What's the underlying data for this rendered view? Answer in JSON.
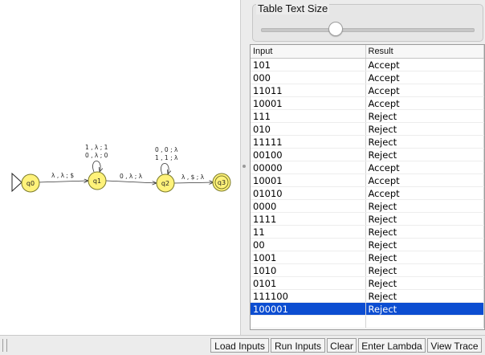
{
  "automaton": {
    "states": [
      "q0",
      "q1",
      "q2",
      "q3"
    ],
    "edges": [
      {
        "from": "q0",
        "to": "q1",
        "label": "λ , λ ; $"
      },
      {
        "from": "q1",
        "to": "q1",
        "labels": [
          "1 , λ ; 1",
          "0 , λ ; 0"
        ]
      },
      {
        "from": "q1",
        "to": "q2",
        "label": "0 , λ ; λ"
      },
      {
        "from": "q2",
        "to": "q2",
        "labels": [
          "0 , 0 ; λ",
          "1 , 1 ; λ"
        ]
      },
      {
        "from": "q2",
        "to": "q3",
        "label": "λ , $ ; λ"
      }
    ],
    "initial": "q0",
    "final": "q3",
    "colors": {
      "state_fill": "#fff27a",
      "state_border": "#7a7a2a"
    }
  },
  "table_text_size": {
    "title": "Table Text Size",
    "value": 0.35
  },
  "results_table": {
    "headers": [
      "Input",
      "Result"
    ],
    "rows": [
      [
        "101",
        "Accept"
      ],
      [
        "000",
        "Accept"
      ],
      [
        "11011",
        "Accept"
      ],
      [
        "10001",
        "Accept"
      ],
      [
        "111",
        "Reject"
      ],
      [
        "010",
        "Reject"
      ],
      [
        "11111",
        "Reject"
      ],
      [
        "00100",
        "Reject"
      ],
      [
        "00000",
        "Accept"
      ],
      [
        "10001",
        "Accept"
      ],
      [
        "01010",
        "Accept"
      ],
      [
        "0000",
        "Reject"
      ],
      [
        "1111",
        "Reject"
      ],
      [
        "11",
        "Reject"
      ],
      [
        "00",
        "Reject"
      ],
      [
        "1001",
        "Reject"
      ],
      [
        "1010",
        "Reject"
      ],
      [
        "0101",
        "Reject"
      ],
      [
        "111100",
        "Reject"
      ],
      [
        "100001",
        "Reject"
      ]
    ],
    "selected_index": 19,
    "selection_color": "#0c4dd1"
  },
  "buttons": {
    "load_inputs": "Load Inputs",
    "run_inputs": "Run Inputs",
    "clear": "Clear",
    "enter_lambda": "Enter Lambda",
    "view_trace": "View Trace"
  }
}
